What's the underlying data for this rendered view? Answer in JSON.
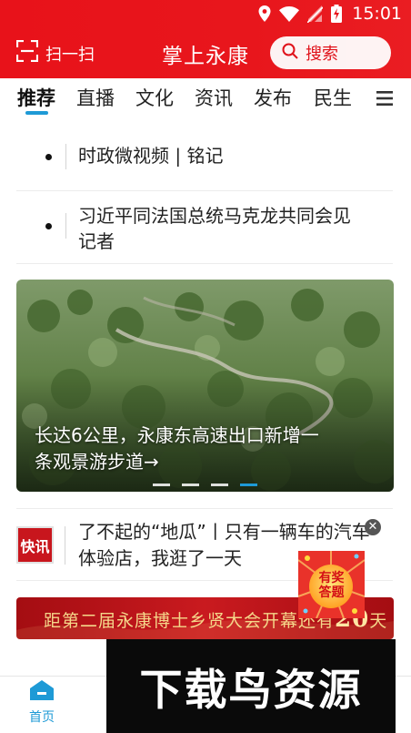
{
  "status_bar": {
    "time": "15:01",
    "icons": [
      "location-icon",
      "wifi-icon",
      "no-sim-icon",
      "battery-charging-icon"
    ]
  },
  "header": {
    "scan_label": "扫一扫",
    "app_title": "掌上永康",
    "search_placeholder": "搜索",
    "accent_color": "#e8121a"
  },
  "tabs": [
    {
      "label": "推荐",
      "active": true
    },
    {
      "label": "直播"
    },
    {
      "label": "文化"
    },
    {
      "label": "资讯"
    },
    {
      "label": "发布"
    },
    {
      "label": "民生"
    }
  ],
  "list_items": [
    {
      "text": "时政微视频 | 铭记"
    },
    {
      "line1": "习近平同法国总统马克龙共同会见",
      "line2": "记者"
    }
  ],
  "banner": {
    "caption_line1": "长达6公里，永康东高速出口新增一",
    "caption_line2": "条观景游步道→",
    "active_dot": 4,
    "dot_count": 4
  },
  "news": {
    "badge": "快讯",
    "line1": "了不起的“地瓜”丨只有一辆车的汽车",
    "line2": "体验店，我逛了一天"
  },
  "award_float": {
    "line1": "有奖",
    "line2": "答题"
  },
  "countdown": {
    "text_before": "距第二届永康博士乡贤大会开幕还有",
    "number": "20",
    "text_after": "天"
  },
  "bottom_nav": {
    "home_label": "首页",
    "active_color": "#1e9ad6"
  },
  "watermark": {
    "text": "下载鸟资源"
  }
}
